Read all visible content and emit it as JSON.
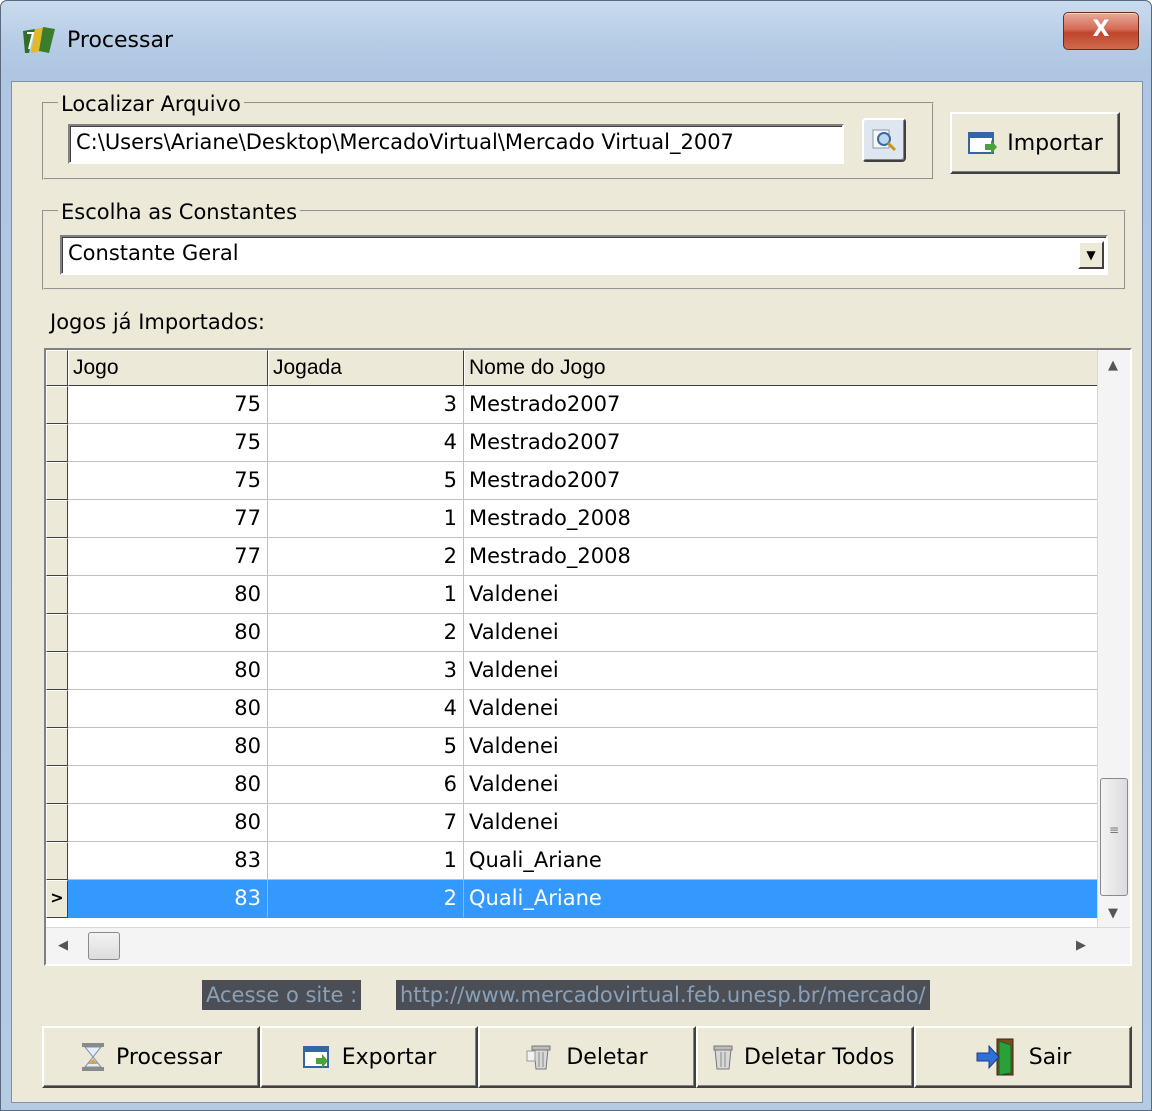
{
  "window": {
    "title": "Processar",
    "close_glyph": "X"
  },
  "localizar": {
    "group_label": "Localizar Arquivo",
    "path_value": "C:\\Users\\Ariane\\Desktop\\MercadoVirtual\\Mercado Virtual_2007",
    "browse_icon": "magnifier-icon",
    "import_label": "Importar"
  },
  "constantes": {
    "group_label": "Escolha as Constantes",
    "selected": "Constante Geral"
  },
  "grid": {
    "caption": "Jogos já Importados:",
    "columns": [
      "Jogo",
      "Jogada",
      "Nome do Jogo"
    ],
    "rows": [
      {
        "jogo": "75",
        "jogada": "3",
        "nome": "Mestrado2007"
      },
      {
        "jogo": "75",
        "jogada": "4",
        "nome": "Mestrado2007"
      },
      {
        "jogo": "75",
        "jogada": "5",
        "nome": "Mestrado2007"
      },
      {
        "jogo": "77",
        "jogada": "1",
        "nome": "Mestrado_2008"
      },
      {
        "jogo": "77",
        "jogada": "2",
        "nome": "Mestrado_2008"
      },
      {
        "jogo": "80",
        "jogada": "1",
        "nome": "Valdenei"
      },
      {
        "jogo": "80",
        "jogada": "2",
        "nome": "Valdenei"
      },
      {
        "jogo": "80",
        "jogada": "3",
        "nome": "Valdenei"
      },
      {
        "jogo": "80",
        "jogada": "4",
        "nome": "Valdenei"
      },
      {
        "jogo": "80",
        "jogada": "5",
        "nome": "Valdenei"
      },
      {
        "jogo": "80",
        "jogada": "6",
        "nome": "Valdenei"
      },
      {
        "jogo": "80",
        "jogada": "7",
        "nome": "Valdenei"
      },
      {
        "jogo": "83",
        "jogada": "1",
        "nome": "Quali_Ariane"
      },
      {
        "jogo": "83",
        "jogada": "2",
        "nome": "Quali_Ariane"
      }
    ],
    "selected_row_index": 13,
    "current_row_marker": ">"
  },
  "site": {
    "label": "Acesse o site :",
    "url": "http://www.mercadovirtual.feb.unesp.br/mercado/"
  },
  "buttons": {
    "processar": "Processar",
    "exportar": "Exportar",
    "deletar": "Deletar",
    "deletar_todos": "Deletar Todos",
    "sair": "Sair"
  },
  "colors": {
    "selection": "#3399ff",
    "face": "#ece9d8"
  }
}
